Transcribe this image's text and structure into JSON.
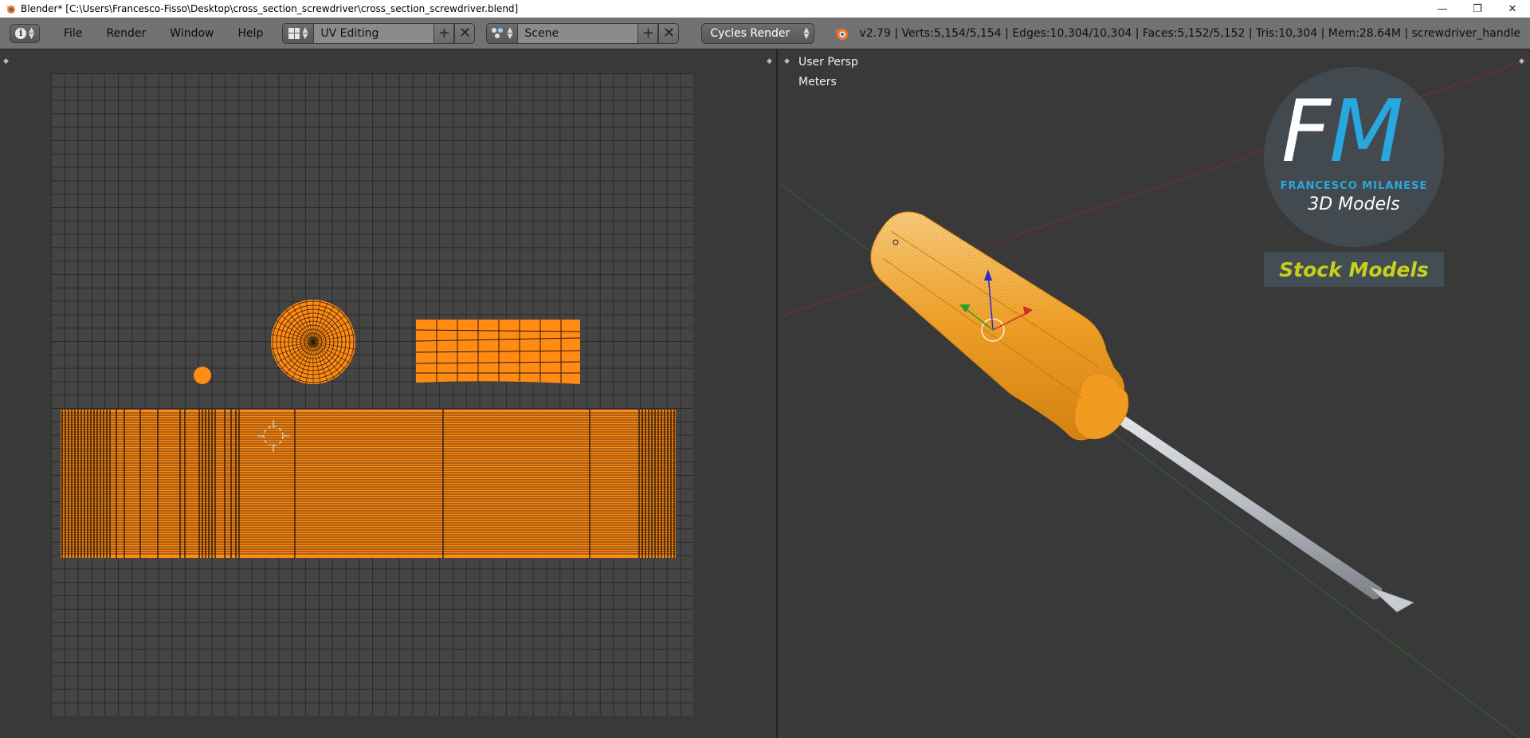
{
  "window": {
    "title": "Blender* [C:\\Users\\Francesco-Fisso\\Desktop\\cross_section_screwdriver\\cross_section_screwdriver.blend]",
    "minimize_glyph": "—",
    "restore_glyph": "❐",
    "close_glyph": "✕"
  },
  "header": {
    "editor_icon_glyph": "i",
    "menus": [
      "File",
      "Render",
      "Window",
      "Help"
    ],
    "screen_layout": "UV Editing",
    "scene": "Scene",
    "render_engine": "Cycles Render",
    "add_glyph": "+",
    "remove_glyph": "✕",
    "stats": "v2.79 | Verts:5,154/5,154 | Edges:10,304/10,304 | Faces:5,152/5,152 | Tris:10,304 | Mem:28.64M | screwdriver_handle"
  },
  "viewport": {
    "perspective": "User Persp",
    "units": "Meters"
  },
  "watermark": {
    "letter_f": "F",
    "letter_m": "M",
    "author": "FRANCESCO MILANESE",
    "subtitle": "3D Models",
    "tag": "Stock Models"
  },
  "colors": {
    "uv_mesh": "#ff8a14",
    "accent_blue": "#29a8e0",
    "stock_yellow": "#c8cf1c",
    "handle_orange": "#f5a52a",
    "shaft_gray": "#b8bcc2"
  }
}
